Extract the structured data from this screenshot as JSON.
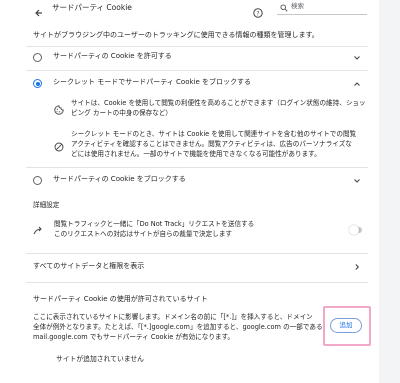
{
  "header": {
    "title": "サードパーティ Cookie",
    "search_placeholder": "検索"
  },
  "intro": "サイトがブラウジング中のユーザーのトラッキングに使用できる情報の種類を管理します。",
  "options": [
    {
      "label": "サードパーティの Cookie を許可する",
      "selected": false,
      "expanded": false
    },
    {
      "label": "シークレット モードでサードパーティ Cookie をブロックする",
      "selected": true,
      "expanded": true
    },
    {
      "label": "サードパーティの Cookie をブロックする",
      "selected": false,
      "expanded": false
    }
  ],
  "details": [
    {
      "icon": "cookie-icon",
      "line1": "サイトは、Cookie を使用して閲覧の利便性を高めることができます（ログイン状態の維持、ショッ",
      "line2": "ピング カートの中身の保存など）"
    },
    {
      "icon": "block-icon",
      "line1": "シークレット モードのとき、サイトは Cookie を使用して関連サイトを含む他のサイトでの閲覧",
      "line2": "アクティビティを確認することはできません。閲覧アクティビティは、広告のパーソナライズな",
      "line3": "どには使用されません。一部のサイトで機能を使用できなくなる可能性があります。"
    }
  ],
  "advanced": {
    "heading": "詳細設定",
    "dnt_label": "閲覧トラフィックと一緒に「Do Not Track」リクエストを送信する",
    "dnt_sub": "このリクエストへの対応はサイトが自らの裁量で決定します",
    "dnt_enabled": false
  },
  "all_site_data_label": "すべてのサイトデータと権限を表示",
  "allowed": {
    "heading": "サードパーティ Cookie の使用が許可されているサイト",
    "desc1": "ここに表示されているサイトに影響します。ドメイン名の前に「[*.]」を挿入すると、ドメイン",
    "desc2": "全体が例外となります。たとえば、「[*.]google.com」を追加すると、google.com の一部である",
    "desc3": "mail.google.com でもサードパーティ Cookie が有効になります。",
    "add_label": "追加",
    "empty_label": "サイトが追加されていません"
  },
  "colors": {
    "accent": "#1a73e8",
    "highlight": "#f2a7c8"
  }
}
